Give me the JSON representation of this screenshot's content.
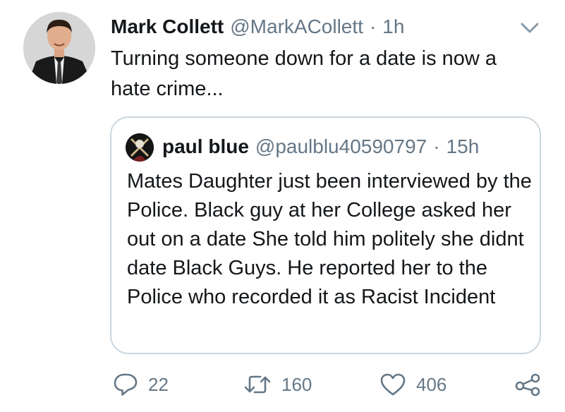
{
  "tweet": {
    "author_name": "Mark Collett",
    "author_handle": "@MarkACollett",
    "separator": "·",
    "time": "1h",
    "text": "Turning someone down for a date is now a hate crime..."
  },
  "quoted_tweet": {
    "author_name": "paul blue",
    "author_handle": "@paulblu40590797",
    "separator": "·",
    "time": "15h",
    "text": "Mates Daughter just been interviewed by the Police. Black guy at her College asked her out on a date She told him politely she didnt date Black Guys. He reported her to the Police who recorded it as Racist Incident"
  },
  "actions": {
    "reply_count": "22",
    "retweet_count": "160",
    "like_count": "406"
  },
  "icons": {
    "reply": "reply-icon",
    "retweet": "retweet-icon",
    "like": "heart-icon",
    "share": "share-icon",
    "menu": "chevron-down-icon"
  },
  "colors": {
    "text": "#14171a",
    "secondary": "#657786",
    "border": "#ccd6dd"
  }
}
